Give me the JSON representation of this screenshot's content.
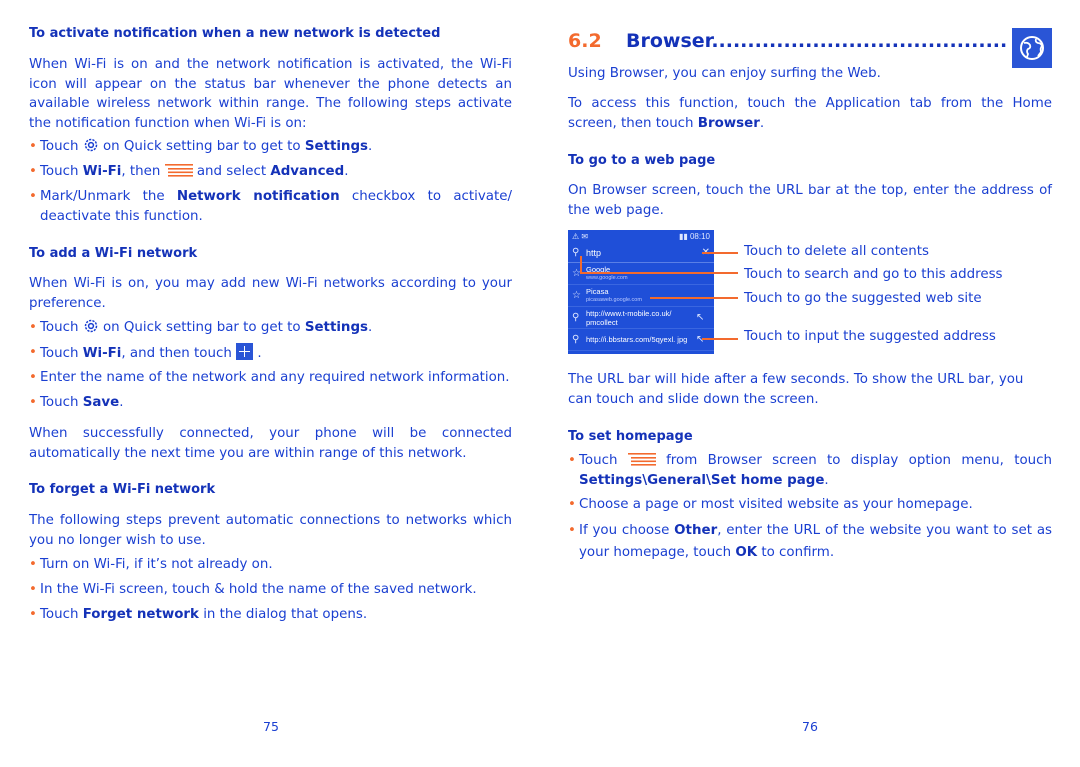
{
  "left_page": {
    "section1": {
      "heading": "To activate notification when a new network is detected",
      "intro": "When Wi-Fi is on and the network notification is activated, the Wi-Fi icon will appear on the status bar whenever the phone detects an available wireless network within range. The following steps activate the notification function when Wi-Fi is on:",
      "bullets": [
        {
          "pre": "Touch ",
          "icon": "settings-gear-icon",
          "mid": " on Quick setting bar to get to ",
          "bold": "Settings",
          "post": "."
        },
        {
          "pre": "Touch ",
          "bold1": "Wi-Fi",
          "mid": ", then ",
          "icon": "menu-icon",
          "mid2": " and select ",
          "bold2": "Advanced",
          "post": "."
        },
        {
          "pre": "Mark/Unmark the ",
          "bold": "Network notification",
          "post": " checkbox to activate/ deactivate this function."
        }
      ]
    },
    "section2": {
      "heading": "To add a Wi-Fi network",
      "intro": "When Wi-Fi is on, you may add new Wi-Fi networks according to your preference.",
      "bullets": [
        {
          "pre": "Touch ",
          "icon": "settings-gear-icon",
          "mid": " on Quick setting bar to get to ",
          "bold": "Settings",
          "post": "."
        },
        {
          "pre": "Touch ",
          "bold": "Wi-Fi",
          "mid": ", and then touch ",
          "icon": "add-icon",
          "post": " ."
        },
        {
          "text": "Enter the name of the network and any required network information."
        },
        {
          "pre": "Touch ",
          "bold": "Save",
          "post": "."
        }
      ],
      "outro": "When successfully connected, your phone will be connected automatically the next time you are within range of this network."
    },
    "section3": {
      "heading": "To forget a Wi-Fi network",
      "intro": "The following steps prevent automatic connections to networks which you no longer wish to use.",
      "bullets": [
        {
          "text": "Turn on Wi-Fi, if it’s not already on."
        },
        {
          "text": "In the Wi-Fi screen, touch & hold the name of the saved network."
        },
        {
          "pre": "Touch ",
          "bold": "Forget network",
          "post": " in the dialog that opens."
        }
      ]
    },
    "page_number": "75"
  },
  "right_page": {
    "title_number": "6.2",
    "title_text": "Browser.......................................................",
    "title_icon": "globe-icon",
    "intro1": "Using Browser, you can enjoy surfing the Web.",
    "intro2_pre": "To access this function, touch the Application tab from the Home screen, then touch ",
    "intro2_bold": "Browser",
    "intro2_post": ".",
    "section1": {
      "heading": "To go to a web page",
      "text": "On Browser screen, touch the URL bar at the top, enter the address of the web page."
    },
    "screenshot": {
      "status_left": "⚠ ✉",
      "status_right": "▮▮ 08:10",
      "url_value": "http",
      "rows": [
        {
          "icon": "star-icon",
          "title": "Google",
          "sub": "www.google.com"
        },
        {
          "icon": "star-icon",
          "title": "Picasa",
          "sub": "picasaweb.google.com"
        },
        {
          "icon": "search-icon",
          "title": "http://www.t-mobile.co.uk/ pmcollect",
          "sub": ""
        },
        {
          "icon": "search-icon",
          "title": "http://i.bbstars.com/5qyexl. jpg",
          "sub": ""
        }
      ]
    },
    "callouts": [
      "Touch to delete all contents",
      "Touch to search and go to this address",
      "Touch to go the suggested web site",
      "Touch to input the suggested address"
    ],
    "after_screenshot": "The URL bar will hide after a few seconds. To show the URL bar, you can touch and slide down the screen.",
    "section2": {
      "heading": "To set homepage",
      "bullets": [
        {
          "pre": "Touch ",
          "icon": "menu-icon",
          "mid": " from Browser screen to display option menu, touch ",
          "bold": "Settings\\General\\Set home page",
          "post": "."
        },
        {
          "text": "Choose a page or most visited website as your homepage."
        },
        {
          "pre": "If you choose ",
          "bold": "Other",
          "mid": ", enter the URL of the website you want to set as your homepage, touch ",
          "bold2": "OK",
          "post": " to confirm."
        }
      ]
    },
    "page_number": "76"
  }
}
